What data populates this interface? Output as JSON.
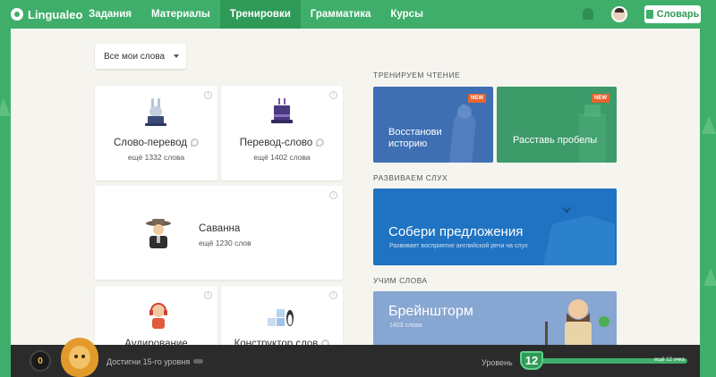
{
  "app": {
    "name": "Lingualeo"
  },
  "nav": {
    "items": [
      {
        "label": "Задания",
        "active": false
      },
      {
        "label": "Материалы",
        "active": false
      },
      {
        "label": "Тренировки",
        "active": true
      },
      {
        "label": "Грамматика",
        "active": false
      },
      {
        "label": "Курсы",
        "active": false
      }
    ],
    "dictionary_label": "Словарь",
    "icons": [
      "paw-logo-icon",
      "bell-icon",
      "user-avatar",
      "book-icon"
    ]
  },
  "filter": {
    "selected": "Все мои слова"
  },
  "trainings": [
    {
      "title": "Слово-перевод",
      "subtitle": "ещё 1332 слова"
    },
    {
      "title": "Перевод-слово",
      "subtitle": "ещё 1402 слова"
    },
    {
      "title": "Саванна",
      "subtitle": "ещё 1230 слов"
    },
    {
      "title": "Аудирование",
      "subtitle": ""
    },
    {
      "title": "Конструктор слов",
      "subtitle": ""
    }
  ],
  "sections": {
    "reading": {
      "label": "ТРЕНИРУЕМ ЧТЕНИЕ",
      "tiles": [
        {
          "title_line1": "Восстанови",
          "title_line2": "историю",
          "badge": "NEW",
          "color": "#3e6fb3"
        },
        {
          "title_line1": "Расставь пробелы",
          "title_line2": "",
          "badge": "NEW",
          "color": "#3d9a69"
        }
      ]
    },
    "listening": {
      "label": "РАЗВИВАЕМ СЛУХ",
      "tile": {
        "title": "Собери предложения",
        "subtitle": "Развивает восприятие английской речи на слух",
        "color": "#1f73c2"
      }
    },
    "words": {
      "label": "УЧИМ СЛОВА",
      "tile": {
        "title": "Брейншторм",
        "subtitle": "1403 слова",
        "color": "#87a6d1"
      }
    }
  },
  "status": {
    "coins": "0",
    "goal": "Достигни 15-го уровня",
    "level_label": "Уровень",
    "level": "12",
    "xp_text": "ещё 12 очка",
    "xp_progress": 0.97
  },
  "colors": {
    "brand_green": "#3fae6a",
    "badge_orange": "#e8642e",
    "dark_bar": "#2b2b2b"
  }
}
